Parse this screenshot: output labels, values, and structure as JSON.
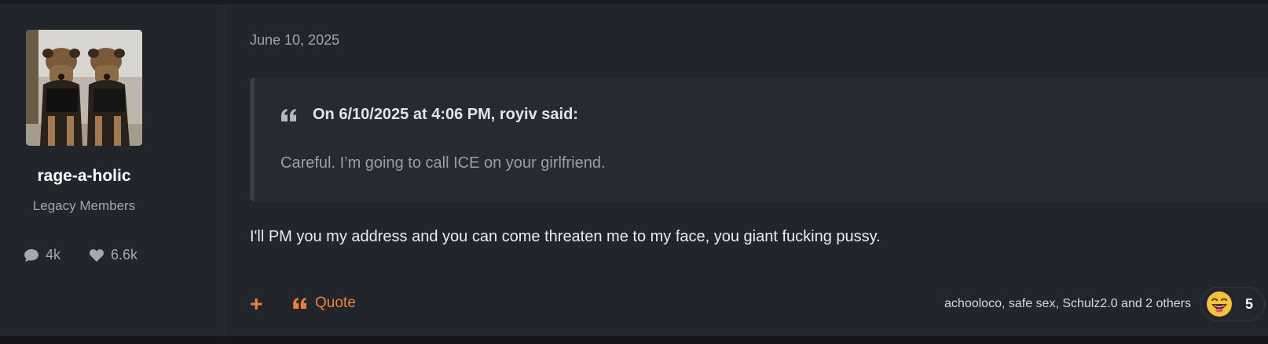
{
  "post": {
    "author": {
      "username": "rage-a-holic",
      "usergroup": "Legacy Members",
      "stats": {
        "posts": "4k",
        "likes": "6.6k"
      },
      "avatar_alt": "avatar-two-dogs"
    },
    "date": "June 10, 2025",
    "quote": {
      "header": "On 6/10/2025 at 4:06 PM, royiv said:",
      "body": "Careful. I’m going to call ICE on your girlfriend."
    },
    "message": "I'll PM you my address and you can come threaten me to my face, you giant fucking pussy.",
    "footer": {
      "add_label": "+",
      "quote_label": "Quote",
      "reactors_text": "achooloco, safe sex, Schulz2.0 and 2 others",
      "reaction_count": "5"
    }
  },
  "colors": {
    "accent": "#f07f3a",
    "background": "#22252c",
    "quote_bg": "#272a32"
  },
  "icons": [
    "chat-bubble-icon",
    "heart-icon",
    "quote-mark-icon",
    "laughing-emoji-icon"
  ]
}
